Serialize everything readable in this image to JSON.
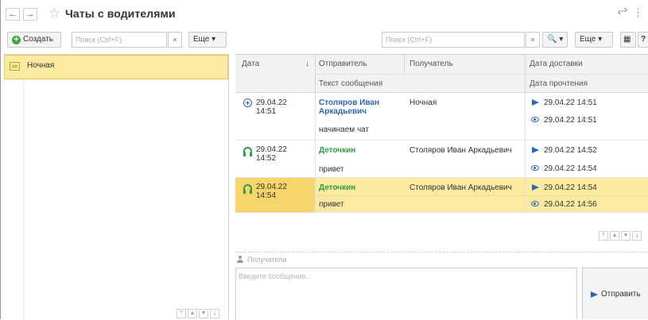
{
  "window": {
    "title": "Чаты с водителями",
    "back_icon": "←",
    "forward_icon": "→",
    "star_icon": "☆",
    "link_icon": "🔗",
    "more_icon": "⋮"
  },
  "left_toolbar": {
    "create_label": "Создать",
    "search_placeholder": "Поиск (Ctrl+F)",
    "clear_label": "×",
    "more_label": "Еще ▾"
  },
  "chats": [
    {
      "label": "Ночная",
      "selected": true
    }
  ],
  "right_toolbar": {
    "search_placeholder": "Поиск (Ctrl+F)",
    "clear_label": "×",
    "find_label": "🔍 ▾",
    "more_label": "Еще ▾",
    "calc_icon": "▦",
    "help_label": "?"
  },
  "grid": {
    "columns": {
      "date": "Дата",
      "sort_icon": "↓",
      "sender": "Отправитель",
      "recipient": "Получатель",
      "delivered": "Дата доставки",
      "text": "Текст сообщения",
      "read": "Дата прочтения"
    },
    "rows": [
      {
        "icon": "plus-circle-icon",
        "date_line1": "29.04.22",
        "date_line2": "14:51",
        "sender_line1": "Столяров Иван",
        "sender_line2": "Аркадьевич",
        "recipient": "Ночная",
        "text": "начинаем чат",
        "delivered": "29.04.22 14:51",
        "read": "29.04.22 14:51",
        "selected": false
      },
      {
        "icon": "headset-icon",
        "date_line1": "29.04.22",
        "date_line2": "14:52",
        "sender_line1": "Деточкин",
        "sender_line2": "",
        "recipient": "Столяров Иван Аркадьевич",
        "text": "привет",
        "delivered": "29.04.22 14:52",
        "read": "29.04.22 14:54",
        "selected": false
      },
      {
        "icon": "headset-icon",
        "date_line1": "29.04.22",
        "date_line2": "14:54",
        "sender_line1": "Деточкин",
        "sender_line2": "",
        "recipient": "Столяров Иван Аркадьевич",
        "text": "привет",
        "delivered": "29.04.22 14:54",
        "read": "29.04.22 14:56",
        "selected": true
      }
    ]
  },
  "scroll_nav": {
    "first": "⤒",
    "up": "▲",
    "down": "▼",
    "last": "⤓"
  },
  "composer": {
    "recipients_placeholder": "Получатели",
    "message_placeholder": "Введите сообщение...",
    "send_label": "Отправить"
  }
}
